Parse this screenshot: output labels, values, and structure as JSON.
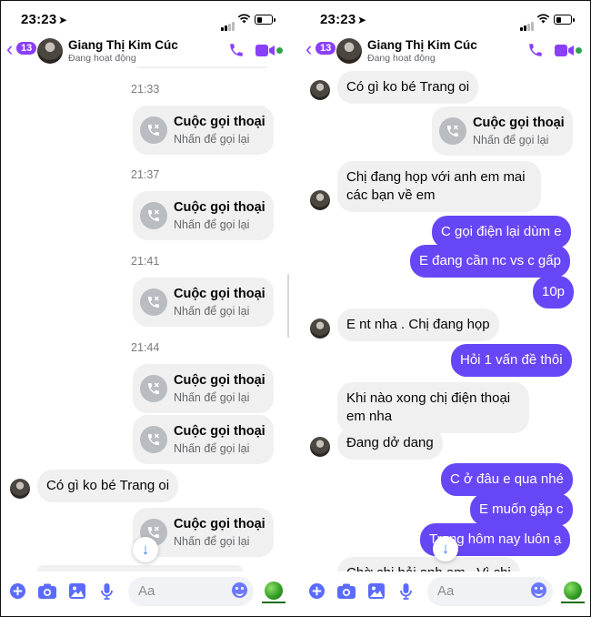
{
  "status": {
    "time": "23:23"
  },
  "header": {
    "back_badge": "13",
    "contact_name": "Giang Thị Kim Cúc",
    "contact_status": "Đang hoạt động"
  },
  "call_card": {
    "title": "Cuộc gọi thoại",
    "subtitle": "Nhấn để gọi lại"
  },
  "left_thread": {
    "timestamps": [
      "21:33",
      "21:37",
      "21:41",
      "21:44"
    ],
    "incoming_message": "Có gì ko bé Trang oi"
  },
  "right_thread": {
    "messages": [
      {
        "from": "contact",
        "text": "Có gì ko bé Trang oi"
      },
      {
        "from": "me",
        "type": "call"
      },
      {
        "from": "contact",
        "text": "Chị đang họp với anh em mai các bạn về em"
      },
      {
        "from": "me",
        "text": "C gọi điện lại dùm e"
      },
      {
        "from": "me",
        "text": "E đang cần nc vs c gấp"
      },
      {
        "from": "me",
        "text": "10p"
      },
      {
        "from": "contact",
        "text": "E nt nha . Chị đang họp"
      },
      {
        "from": "me",
        "text": "Hỏi 1 vấn đề thôi"
      },
      {
        "from": "contact",
        "text": "Khi nào xong chị điện thoại em nha"
      },
      {
        "from": "contact",
        "text": "Đang dở dang"
      },
      {
        "from": "me",
        "text": "C ở đâu e qua nhé"
      },
      {
        "from": "me",
        "text": "E muốn gặp c"
      },
      {
        "from": "me",
        "text": "Trong hôm nay luôn ạ"
      },
      {
        "from": "contact",
        "text": "Chờ chị hỏi anh em . Vì chị"
      }
    ]
  },
  "composer": {
    "placeholder": "Aa"
  },
  "colors": {
    "accent": "#8a3ffc",
    "outgoing_bubble": "#6747f5",
    "incoming_bubble": "#f0f0f0",
    "online": "#31a24c"
  },
  "icons": [
    "location-arrow-icon",
    "signal-icon",
    "wifi-icon",
    "battery-icon",
    "back-chevron-icon",
    "phone-icon",
    "video-icon",
    "missed-call-icon",
    "arrow-down-icon",
    "plus-icon",
    "camera-icon",
    "image-icon",
    "mic-icon",
    "emoji-icon",
    "reaction-ball-icon"
  ]
}
